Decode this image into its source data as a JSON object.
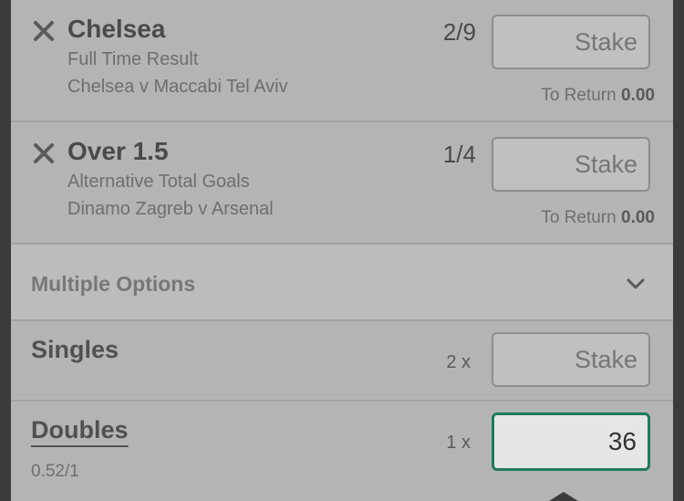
{
  "selections": [
    {
      "title": "Chelsea",
      "market": "Full Time Result",
      "event": "Chelsea v Maccabi Tel Aviv",
      "odds": "2/9",
      "stake_placeholder": "Stake",
      "to_return_label": "To Return",
      "to_return_value": "0.00"
    },
    {
      "title": "Over 1.5",
      "market": "Alternative Total Goals",
      "event": "Dinamo Zagreb v Arsenal",
      "odds": "1/4",
      "stake_placeholder": "Stake",
      "to_return_label": "To Return",
      "to_return_value": "0.00"
    }
  ],
  "multiple_options": {
    "label": "Multiple Options"
  },
  "singles": {
    "label": "Singles",
    "count": "2 x",
    "stake_placeholder": "Stake"
  },
  "doubles": {
    "label": "Doubles",
    "odds": "0.52/1",
    "count": "1 x",
    "stake_value": "36"
  },
  "colors": {
    "active_border": "#1e7a5a",
    "panel_bg": "#b4b4b4",
    "outer_bg": "#3b3b3b"
  },
  "icons": {
    "remove": "close-icon",
    "expand": "chevron-down-icon"
  }
}
